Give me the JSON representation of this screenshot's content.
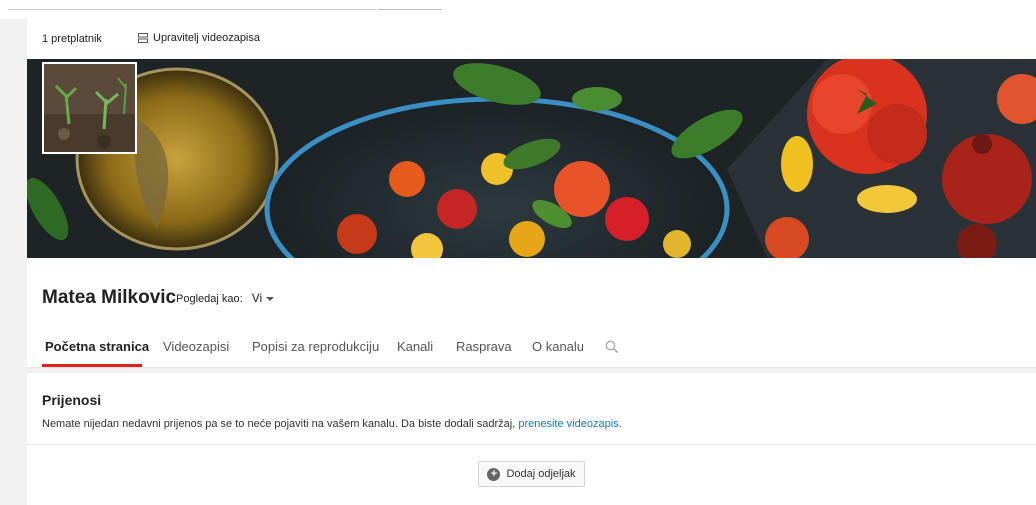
{
  "channel": {
    "subscriber_count": "1 pretplatnik",
    "manage_videos_label": "Upravitelj videozapisa",
    "name": "Matea Milkovic",
    "view_as_label": "Pogledaj kao:",
    "view_as_value": "Vi"
  },
  "tabs": [
    {
      "label": "Početna stranica",
      "active": true
    },
    {
      "label": "Videozapisi",
      "active": false
    },
    {
      "label": "Popisi za reprodukciju",
      "active": false
    },
    {
      "label": "Kanali",
      "active": false
    },
    {
      "label": "Rasprava",
      "active": false
    },
    {
      "label": "O kanalu",
      "active": false
    }
  ],
  "uploads": {
    "title": "Prijenosi",
    "message": "Nemate nijedan nedavni prijenos pa se to neće pojaviti na vašem kanalu. Da biste dodali sadržaj,",
    "link_text": "prenesite videozapis",
    "link_suffix": "."
  },
  "add_section_label": "Dodaj odjeljak",
  "icons": {
    "manage": "video-manager-icon",
    "search": "search-icon",
    "add": "plus-circle-icon",
    "caret": "caret-down-icon"
  },
  "colors": {
    "active_tab_underline": "#e62117",
    "link": "#167ac6"
  }
}
